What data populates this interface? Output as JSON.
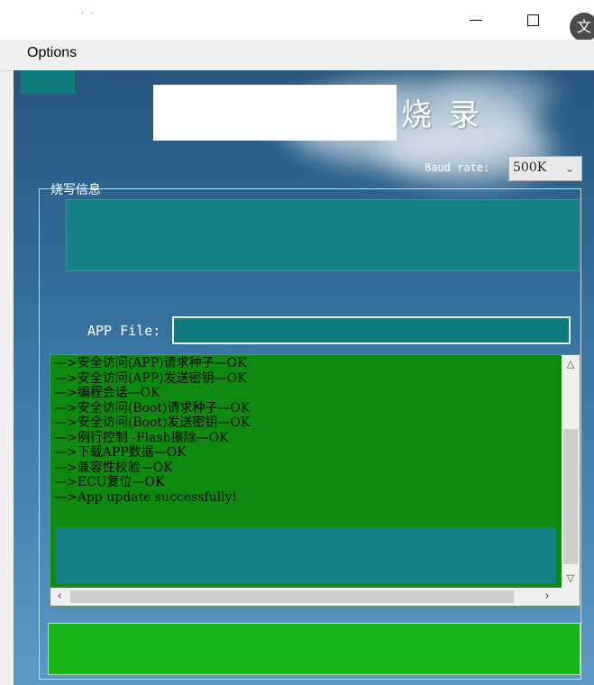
{
  "window": {
    "title_text": "· ·",
    "close_glyph": "文"
  },
  "menu": {
    "options_label": "Options"
  },
  "header": {
    "title": "烧 录"
  },
  "baud": {
    "label": "Baud rate:",
    "value": "500K"
  },
  "group": {
    "title": "烧写信息"
  },
  "app_file": {
    "label": "APP File:",
    "value": ""
  },
  "log": {
    "lines": [
      "—>安全访问(APP)请求种子—OK",
      "—>安全访问(APP)发送密钥—OK",
      "—>编程会话—OK",
      "—>安全访问(Boot)请求种子—OK",
      "—>安全访问(Boot)发送密钥—OK",
      "—>例行控制 -Flash擦除—OK",
      "—>下载APP数据—OK",
      "—>兼容性校验—OK",
      "—>ECU复位—OK",
      "—>App update successfully!"
    ]
  },
  "colors": {
    "teal": "#138285",
    "log_green": "#0e8a0e",
    "status_green": "#16b416"
  }
}
